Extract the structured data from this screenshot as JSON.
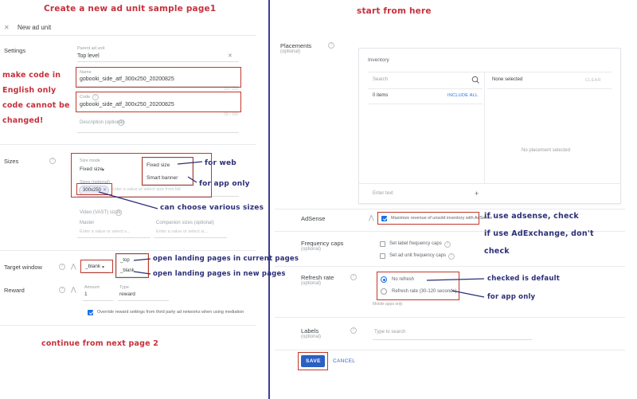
{
  "meta": {
    "accent_red": "#c6303c",
    "accent_blue": "#2b2f77",
    "primary_blue": "#2b5fc4",
    "box_red": "#c0392b"
  },
  "annotations": {
    "title_left": "Create a new ad unit sample page1",
    "title_right": "start from here",
    "make_code_line1": "make code in",
    "make_code_line2": "English only",
    "make_code_line3": "code cannot be",
    "make_code_line4": "changed!",
    "for_web": "for web",
    "for_app_only_sizes": "for app only",
    "various_sizes": "can choose various sizes",
    "current_pages": "open landing pages in current pages",
    "new_pages": "open landing pages in new pages",
    "continue_next": "continue from next page 2",
    "adsense_line1": "if use adsense, check",
    "adsense_line2": "if use AdExchange, don't",
    "adsense_line3": "check",
    "checked_default": "checked is default",
    "for_app_only_refresh": "for app only"
  },
  "left_panel": {
    "close_icon": "close-icon",
    "header_title": "New ad unit",
    "settings": {
      "label": "Settings",
      "parent_ad_unit_label": "Parent ad unit",
      "parent_ad_unit_value": "Top level",
      "clear_icon": "close-icon",
      "name_label": "Name",
      "name_value": "gobooki_side_atf_300x250_20200825",
      "name_counter": "33 / 255",
      "code_label": "Code",
      "code_value": "gobooki_side_atf_300x250_20200825",
      "code_counter": "33 / 100",
      "description_label": "Description (optional)"
    },
    "sizes": {
      "label": "Sizes",
      "size_mode_label": "Size mode",
      "size_mode_value": "Fixed size",
      "mode_options": [
        "Fixed size",
        "Smart banner"
      ],
      "sizes_label": "Sizes (optional)",
      "size_chip": "300x250",
      "sizes_placeholder": "Enter a value or select size from list",
      "vast_label": "Video (VAST) sizes",
      "master_label": "Master",
      "master_placeholder": "Enter a value or select s...",
      "companion_label": "Companion sizes (optional)",
      "companion_placeholder": "Enter a value or select si..."
    },
    "target_window": {
      "label": "Target window",
      "value": "_blank",
      "options": [
        "_top",
        "_blank"
      ]
    },
    "reward": {
      "label": "Reward",
      "amount_label": "Amount",
      "amount_value": "1",
      "type_label": "Type",
      "type_value": "reward",
      "override_label": "Override reward settings from third party ad networks when using mediation",
      "override_checked": true
    }
  },
  "right_panel": {
    "placements": {
      "label": "Placements",
      "sub": "(optional)",
      "card_title": "Inventory",
      "search_placeholder": "Search",
      "search_icon": "search-icon",
      "items_count": "0 items",
      "include_all": "INCLUDE ALL",
      "none_selected": "None selected",
      "clear": "CLEAR",
      "no_placement": "No placement selected",
      "enter_text_placeholder": "Enter text",
      "add_icon": "plus-icon"
    },
    "adsense": {
      "label": "AdSense",
      "checkbox_label": "Maximize revenue of unsold inventory with AdSense",
      "checked": true
    },
    "frequency_caps": {
      "label": "Frequency caps",
      "sub": "(optional)",
      "options": [
        {
          "label": "Set label frequency caps",
          "checked": false
        },
        {
          "label": "Set ad unit frequency caps",
          "checked": false
        }
      ]
    },
    "refresh_rate": {
      "label": "Refresh rate",
      "sub": "(optional)",
      "options": [
        {
          "label": "No refresh",
          "selected": true
        },
        {
          "label": "Refresh rate (30-120 seconds)",
          "selected": false
        }
      ],
      "helper": "Mobile apps only"
    },
    "labels": {
      "label": "Labels",
      "sub": "(optional)",
      "placeholder": "Type to search"
    },
    "actions": {
      "save": "SAVE",
      "cancel": "CANCEL"
    }
  }
}
